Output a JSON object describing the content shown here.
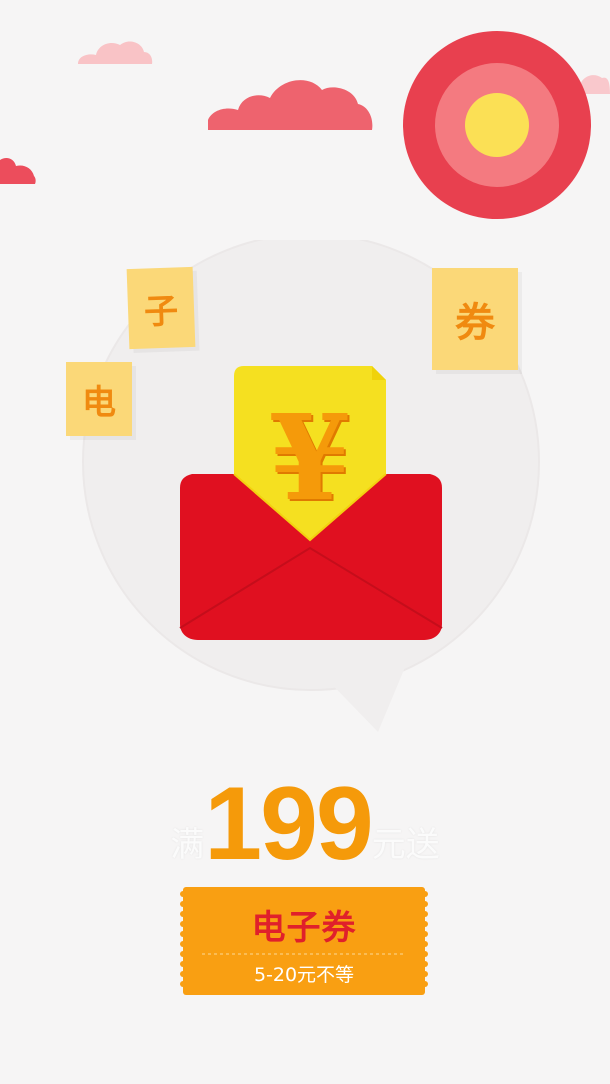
{
  "cards": {
    "dian": "电",
    "zi": "子",
    "quan": "券"
  },
  "envelope": {
    "currency_symbol": "¥"
  },
  "promo": {
    "prefix": "满",
    "amount": "199",
    "suffix": "元送"
  },
  "ticket": {
    "title": "电子券",
    "subtitle": "5-20元不等"
  },
  "colors": {
    "red": "#e01020",
    "orange": "#f59a0a",
    "yellow": "#f5e020",
    "sun_ring": "#e8404f",
    "sun_core": "#fbe055"
  },
  "icons": [
    "cloud-icon",
    "sun-icon",
    "red-envelope-icon",
    "yuan-icon",
    "speech-bubble-icon"
  ]
}
